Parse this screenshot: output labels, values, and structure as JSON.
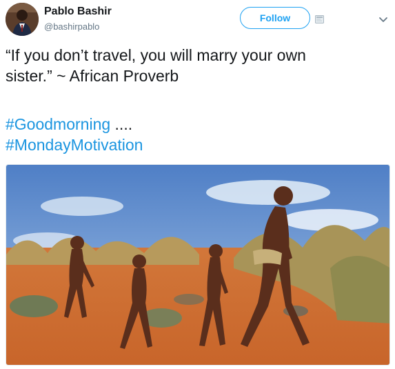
{
  "user": {
    "display_name": "Pablo Bashir",
    "handle": "@bashirpablo"
  },
  "follow_label": "Follow",
  "tweet": {
    "line1": "“If you don’t travel, you will marry your own",
    "line2": "sister.” ~ African Proverb",
    "hashtag1": "#Goodmorning",
    "hashtag1_suffix": " ....",
    "hashtag2": "#MondayMotivation"
  },
  "colors": {
    "accent": "#1da1f2",
    "hashtag": "#1b95e0",
    "secondary_text": "#657786"
  },
  "icons": {
    "external": "external-link-icon",
    "menu": "chevron-down-icon"
  }
}
